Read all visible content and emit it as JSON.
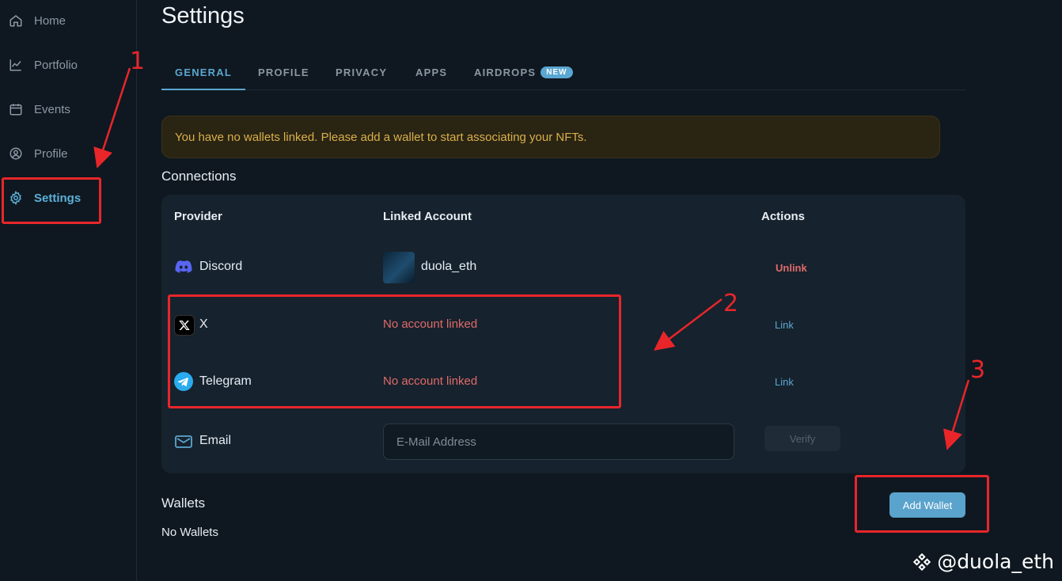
{
  "sidebar": {
    "items": [
      {
        "label": "Home",
        "icon": "home-icon"
      },
      {
        "label": "Portfolio",
        "icon": "chart-line-icon"
      },
      {
        "label": "Events",
        "icon": "calendar-icon"
      },
      {
        "label": "Profile",
        "icon": "user-circle-icon"
      },
      {
        "label": "Settings",
        "icon": "gear-icon",
        "active": true
      }
    ]
  },
  "page": {
    "title": "Settings"
  },
  "tabs": [
    {
      "label": "GENERAL",
      "active": true
    },
    {
      "label": "PROFILE"
    },
    {
      "label": "PRIVACY"
    },
    {
      "label": "APPS"
    },
    {
      "label": "AIRDROPS",
      "badge": "NEW"
    }
  ],
  "alert": {
    "text": "You have no wallets linked. Please add a wallet to start associating your NFTs."
  },
  "connections": {
    "title": "Connections",
    "headers": {
      "provider": "Provider",
      "account": "Linked Account",
      "actions": "Actions"
    },
    "rows": [
      {
        "provider": "Discord",
        "icon": "discord-icon",
        "account": "duola_eth",
        "action": "Unlink"
      },
      {
        "provider": "X",
        "icon": "x-logo-icon",
        "account": "No account linked",
        "action": "Link"
      },
      {
        "provider": "Telegram",
        "icon": "telegram-icon",
        "account": "No account linked",
        "action": "Link"
      },
      {
        "provider": "Email",
        "icon": "mail-icon",
        "placeholder": "E-Mail Address",
        "action": "Verify"
      }
    ]
  },
  "wallets": {
    "title": "Wallets",
    "empty_text": "No Wallets",
    "add_label": "Add Wallet"
  },
  "annotations": {
    "n1": "1",
    "n2": "2",
    "n3": "3"
  },
  "watermark": {
    "text": "@duola_eth"
  },
  "colors": {
    "background": "#0f1820",
    "card": "#16222d",
    "accent": "#5ba7cf",
    "alert_text": "#d9b04a",
    "danger": "#e06a6a",
    "annotation": "#e8262a"
  }
}
